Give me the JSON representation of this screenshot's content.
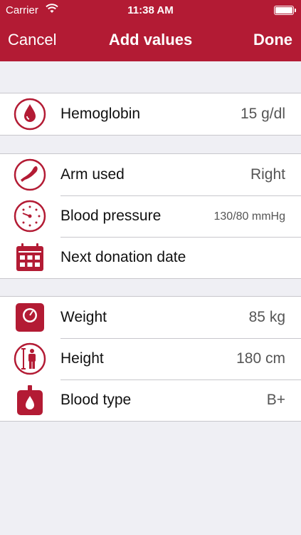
{
  "status_bar": {
    "carrier": "Carrier",
    "time": "11:38 AM"
  },
  "nav": {
    "cancel_label": "Cancel",
    "title": "Add values",
    "done_label": "Done"
  },
  "colors": {
    "accent": "#b31b34",
    "background": "#efeff4",
    "separator": "#c8c7cc"
  },
  "sections": [
    {
      "rows": [
        {
          "icon": "blood-drop-icon",
          "label": "Hemoglobin",
          "value": "15 g/dl"
        }
      ]
    },
    {
      "rows": [
        {
          "icon": "arm-icon",
          "label": "Arm used",
          "value": "Right"
        },
        {
          "icon": "pressure-gauge-icon",
          "label": "Blood pressure",
          "value": "130/80 mmHg"
        },
        {
          "icon": "calendar-icon",
          "label": "Next donation date",
          "value": ""
        }
      ]
    },
    {
      "rows": [
        {
          "icon": "scale-icon",
          "label": "Weight",
          "value": "85 kg"
        },
        {
          "icon": "height-icon",
          "label": "Height",
          "value": "180 cm"
        },
        {
          "icon": "blood-bag-icon",
          "label": "Blood type",
          "value": "B+"
        }
      ]
    }
  ]
}
